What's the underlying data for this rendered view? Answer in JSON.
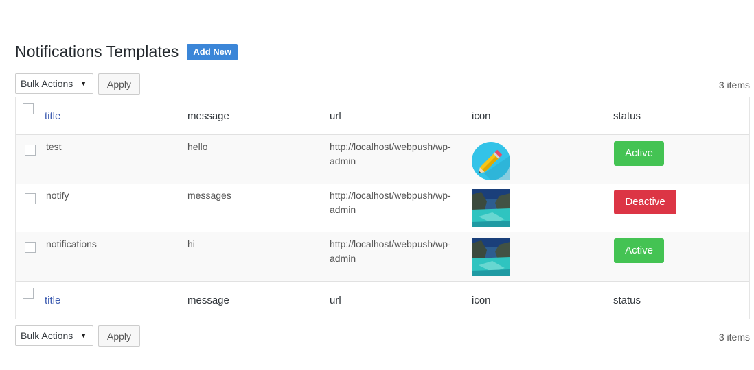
{
  "page": {
    "title": "Notifications Templates",
    "add_new_label": "Add New"
  },
  "tablenav": {
    "bulk_actions": "Bulk Actions",
    "apply": "Apply",
    "items_count": "3 items"
  },
  "columns": {
    "title": "title",
    "message": "message",
    "url": "url",
    "icon": "icon",
    "status": "status"
  },
  "rows": [
    {
      "title": "test",
      "message": "hello",
      "url": "http://localhost/webpush/wp-admin",
      "icon": "pencil-circle-icon",
      "status": "Active"
    },
    {
      "title": "notify",
      "message": "messages",
      "url": "http://localhost/webpush/wp-admin",
      "icon": "lagoon-image",
      "status": "Deactive"
    },
    {
      "title": "notifications",
      "message": "hi",
      "url": "http://localhost/webpush/wp-admin",
      "icon": "lagoon-image",
      "status": "Active"
    }
  ],
  "colors": {
    "accent": "#3b86d8",
    "active": "#44c353",
    "deactive": "#dc3545",
    "link": "#3c5bb0"
  }
}
